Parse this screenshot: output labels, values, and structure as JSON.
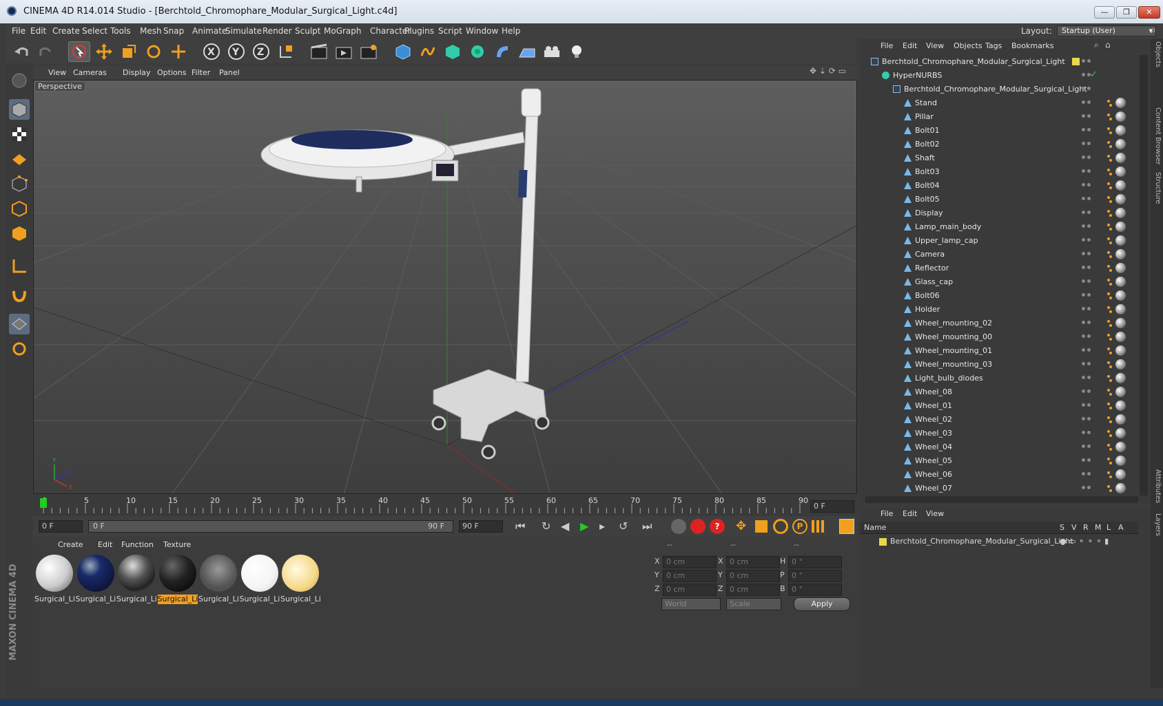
{
  "window": {
    "title": "CINEMA 4D R14.014 Studio - [Berchtold_Chromophare_Modular_Surgical_Light.c4d]"
  },
  "menubar": {
    "items": [
      "File",
      "Edit",
      "Create",
      "Select",
      "Tools",
      "Mesh",
      "Snap",
      "Animate",
      "Simulate",
      "Render",
      "Sculpt",
      "MoGraph",
      "Character",
      "Plugins",
      "Script",
      "Window",
      "Help"
    ],
    "layout_label": "Layout:",
    "layout_value": "Startup (User)"
  },
  "viewport": {
    "menu": [
      "View",
      "Cameras",
      "Display",
      "Options",
      "Filter",
      "Panel"
    ],
    "label": "Perspective"
  },
  "timeline": {
    "ticks": [
      "0",
      "5",
      "10",
      "15",
      "20",
      "25",
      "30",
      "35",
      "40",
      "45",
      "50",
      "55",
      "60",
      "65",
      "70",
      "75",
      "80",
      "85",
      "90"
    ],
    "current": "0 F"
  },
  "transport": {
    "start": "0 F",
    "range_start": "0 F",
    "range_end": "90 F",
    "end": "90 F"
  },
  "materials": {
    "menu": [
      "Create",
      "Edit",
      "Function",
      "Texture"
    ],
    "items": [
      {
        "label": "Surgical_Li",
        "style": "white-logo"
      },
      {
        "label": "Surgical_Li",
        "style": "navy"
      },
      {
        "label": "Surgical_Li",
        "style": "chrome"
      },
      {
        "label": "Surgical_Li",
        "style": "black",
        "selected": true
      },
      {
        "label": "Surgical_Li",
        "style": "glass"
      },
      {
        "label": "Surgical_Li",
        "style": "white"
      },
      {
        "label": "Surgical_Li",
        "style": "cream"
      }
    ]
  },
  "coords": {
    "headers": [
      "--",
      "--",
      "--"
    ],
    "rows": [
      {
        "a": "X",
        "av": "0 cm",
        "b": "X",
        "bv": "0 cm",
        "c": "H",
        "cv": "0 °"
      },
      {
        "a": "Y",
        "av": "0 cm",
        "b": "Y",
        "bv": "0 cm",
        "c": "P",
        "cv": "0 °"
      },
      {
        "a": "Z",
        "av": "0 cm",
        "b": "Z",
        "bv": "0 cm",
        "c": "B",
        "cv": "0 °"
      }
    ],
    "mode1": "World",
    "mode2": "Scale",
    "apply": "Apply"
  },
  "objects": {
    "menu": [
      "File",
      "Edit",
      "View",
      "Objects",
      "Tags",
      "Bookmarks"
    ],
    "root": "Berchtold_Chromophare_Modular_Surgical_Light",
    "hypernurbs": "HyperNURBS",
    "group": "Berchtold_Chromophare_Modular_Surgical_Light",
    "children": [
      "Stand",
      "Pillar",
      "Bolt01",
      "Bolt02",
      "Shaft",
      "Bolt03",
      "Bolt04",
      "Bolt05",
      "Display",
      "Lamp_main_body",
      "Upper_lamp_cap",
      "Camera",
      "Reflector",
      "Glass_cap",
      "Bolt06",
      "Holder",
      "Wheel_mounting_02",
      "Wheel_mounting_00",
      "Wheel_mounting_01",
      "Wheel_mounting_03",
      "Light_bulb_diodes",
      "Wheel_08",
      "Wheel_01",
      "Wheel_02",
      "Wheel_03",
      "Wheel_04",
      "Wheel_05",
      "Wheel_06",
      "Wheel_07"
    ]
  },
  "layers": {
    "menu": [
      "File",
      "Edit",
      "View"
    ],
    "col_name": "Name",
    "cols": [
      "S",
      "V",
      "R",
      "M",
      "L",
      "A"
    ],
    "layer": "Berchtold_Chromophare_Modular_Surgical_Light"
  },
  "side_tabs": [
    "Objects",
    "Content Browser",
    "Structure",
    "Attributes",
    "Layers"
  ],
  "brand": "MAXON CINEMA 4D"
}
